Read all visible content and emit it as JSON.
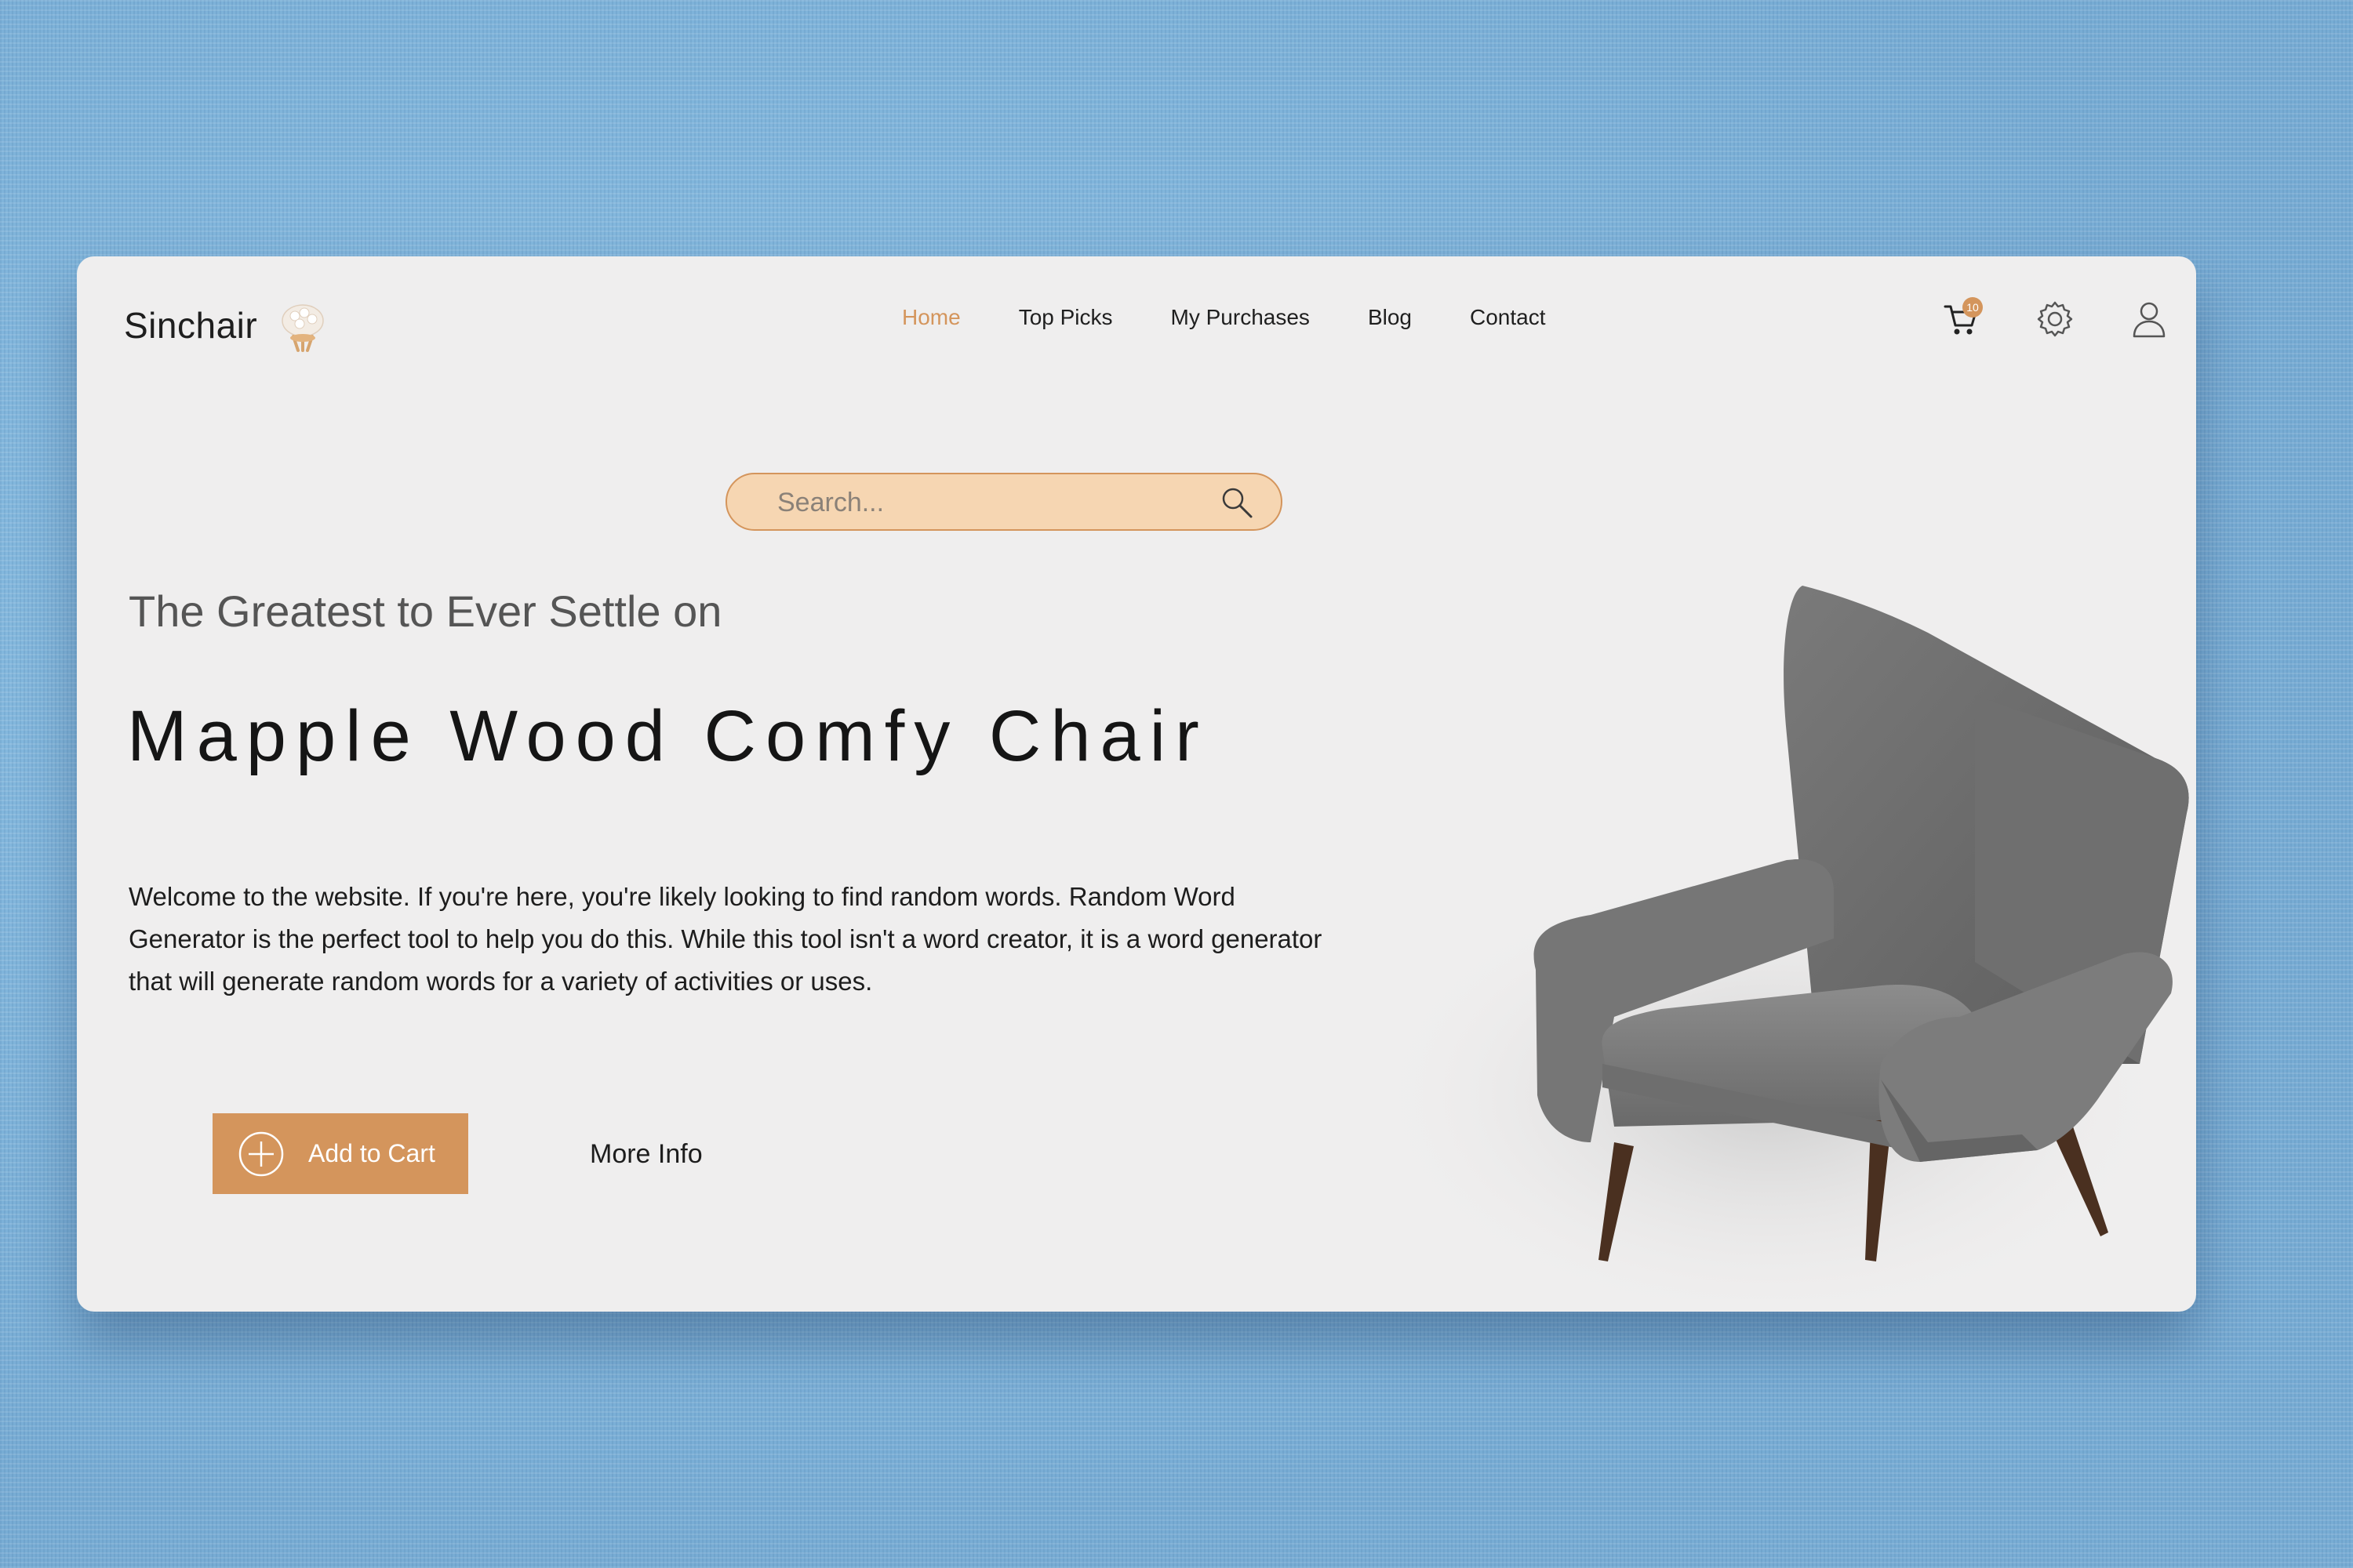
{
  "brand": {
    "name": "Sinchair",
    "accent": "#d4955c"
  },
  "nav": {
    "items": [
      {
        "label": "Home",
        "active": true
      },
      {
        "label": "Top Picks"
      },
      {
        "label": "My Purchases"
      },
      {
        "label": "Blog"
      },
      {
        "label": "Contact"
      }
    ]
  },
  "header_icons": {
    "cart": {
      "icon": "cart-icon",
      "count": "10"
    },
    "settings": {
      "icon": "gear-icon"
    },
    "account": {
      "icon": "user-icon"
    }
  },
  "search": {
    "placeholder": "Search...",
    "value": ""
  },
  "hero": {
    "tagline": "The Greatest to Ever Settle on",
    "title": "Mapple Wood Comfy Chair",
    "description": "Welcome to the website. If you're here, you're likely looking to find random words. Random Word Generator is the perfect tool to help you do this. While this tool isn't a word creator, it is a word generator that will generate random words for a variety of activities or uses."
  },
  "actions": {
    "add_to_cart": "Add to Cart",
    "more_info": "More Info"
  },
  "colors": {
    "background": "#7fb3da",
    "card": "#efeeee",
    "search_fill": "#f6d6b2"
  }
}
